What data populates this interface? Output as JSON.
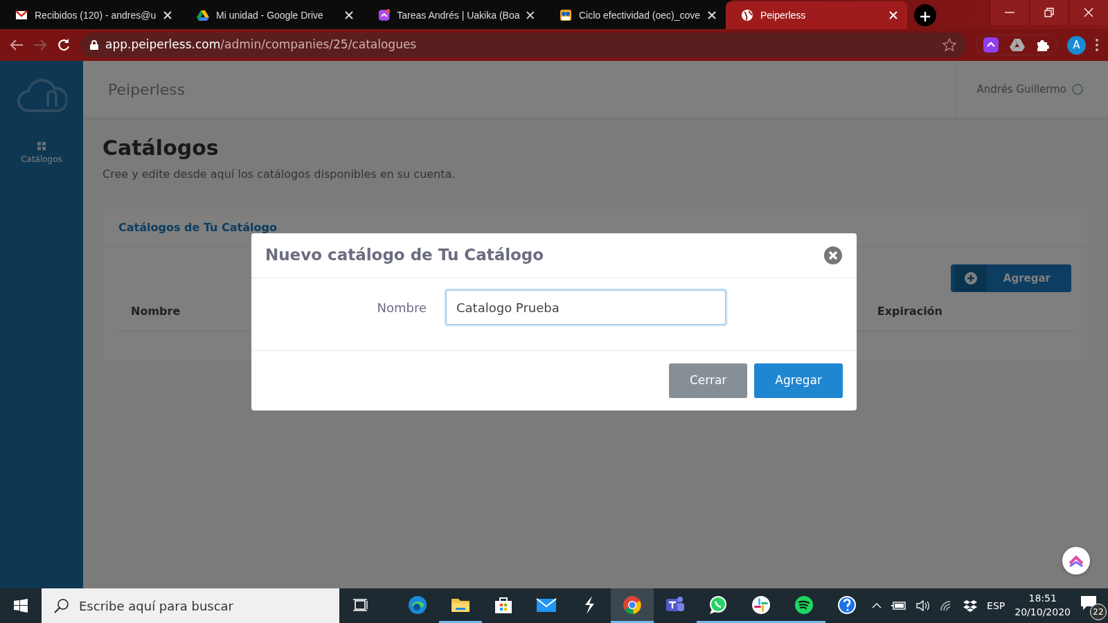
{
  "browser": {
    "tabs": [
      {
        "kind": "mail",
        "title": "Recibidos (120) - andres@u",
        "selected": false
      },
      {
        "kind": "drive",
        "title": "Mi unidad - Google Drive",
        "selected": false
      },
      {
        "kind": "tasks",
        "title": "Tareas Andrés | Uakika (Boa",
        "selected": false
      },
      {
        "kind": "people",
        "title": "Ciclo efectividad (oec)_cove",
        "selected": false
      },
      {
        "kind": "globe",
        "title": "Peiperless",
        "selected": true
      }
    ],
    "address": {
      "host": "app.peiperless.com",
      "path": "/admin/companies/25/catalogues"
    },
    "profile": "A"
  },
  "app": {
    "brand": "Peiperless",
    "user": "Andrés Guillermo",
    "sidebar": [
      {
        "label": "Catálogos",
        "selected": true
      }
    ],
    "title": "Catálogos",
    "subtitle": "Cree y edite desde aquí los catálogos disponibles en su cuenta.",
    "card_title": "Catálogos de Tu Catálogo",
    "add_button": "Agregar",
    "columns": [
      "Nombre",
      "Expiración"
    ]
  },
  "modal": {
    "title": "Nuevo catálogo de Tu Catálogo",
    "field_label": "Nombre",
    "field_value": "Catalogo Prueba",
    "buttons": [
      {
        "kind": "secondary",
        "label": "Cerrar"
      },
      {
        "kind": "primary",
        "label": "Agregar"
      }
    ]
  },
  "taskbar": {
    "search_placeholder": "Escribe aquí para buscar",
    "apps": [
      {
        "kind": "edge",
        "open": false,
        "selected": false
      },
      {
        "kind": "folder",
        "open": true,
        "selected": false
      },
      {
        "kind": "store",
        "open": false,
        "selected": false
      },
      {
        "kind": "mail",
        "open": false,
        "selected": false
      },
      {
        "kind": "bolt",
        "open": false,
        "selected": false
      },
      {
        "kind": "chrome",
        "open": true,
        "selected": true
      },
      {
        "kind": "teams",
        "open": false,
        "selected": false
      },
      {
        "kind": "chat",
        "open": true,
        "selected": false
      },
      {
        "kind": "slack",
        "open": true,
        "selected": false
      },
      {
        "kind": "music",
        "open": true,
        "selected": false
      },
      {
        "kind": "help",
        "open": false,
        "selected": false
      }
    ],
    "language": "ESP",
    "time": "18:51",
    "date": "20/10/2020",
    "notifications": "22"
  }
}
